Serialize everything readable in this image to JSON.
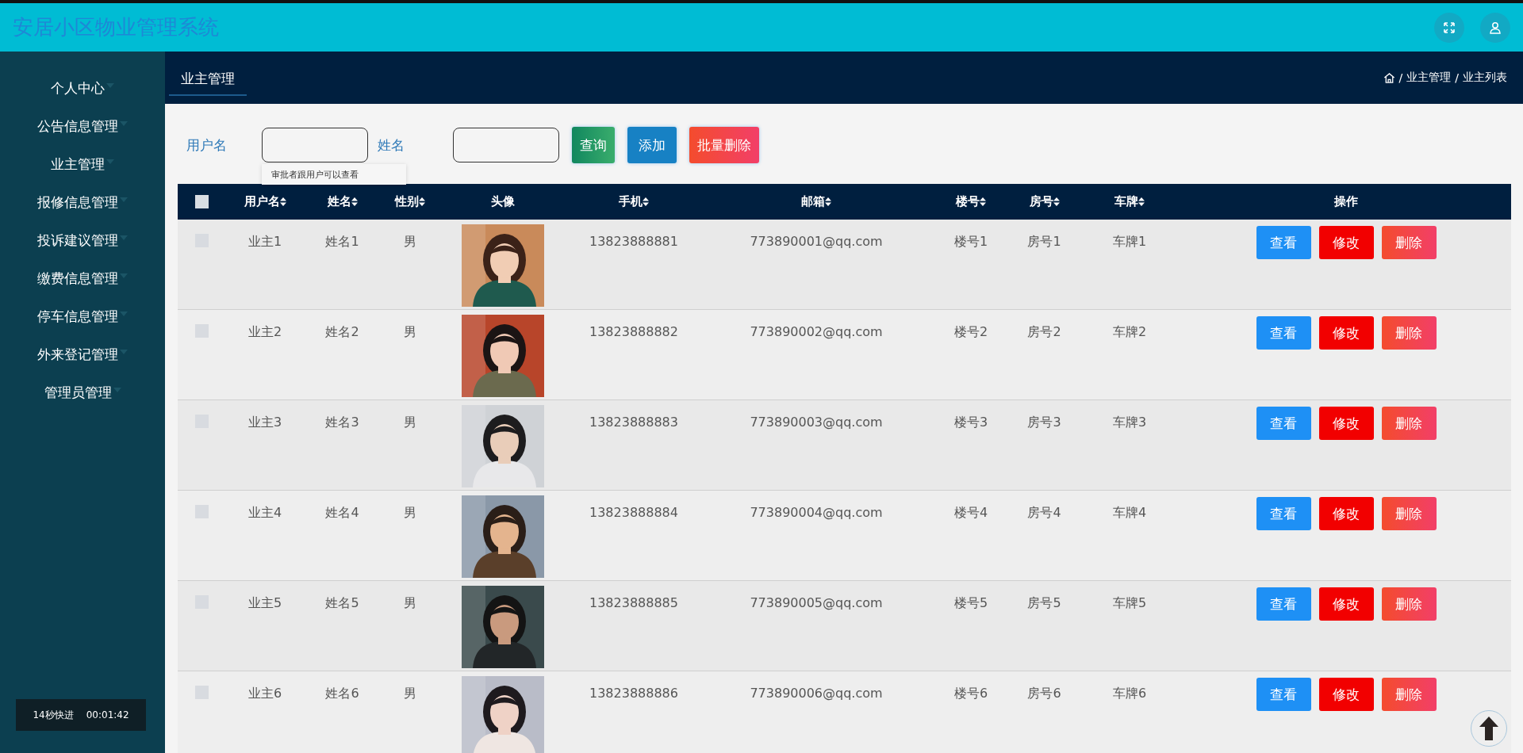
{
  "app": {
    "title": "安居小区物业管理系统"
  },
  "sidebar": {
    "items": [
      {
        "label": "个人中心"
      },
      {
        "label": "公告信息管理"
      },
      {
        "label": "业主管理"
      },
      {
        "label": "报修信息管理"
      },
      {
        "label": "投诉建议管理"
      },
      {
        "label": "缴费信息管理"
      },
      {
        "label": "停车信息管理"
      },
      {
        "label": "外来登记管理"
      },
      {
        "label": "管理员管理"
      }
    ]
  },
  "tab": {
    "label": "业主管理",
    "selected": true
  },
  "breadcrumb": [
    {
      "separator": "/",
      "label": "业主管理"
    },
    {
      "separator": "/",
      "label": "业主列表"
    }
  ],
  "search": {
    "fields": [
      {
        "label": "用户名"
      },
      {
        "label": "姓名"
      }
    ],
    "tooltip": "审批者跟用户可以查看",
    "buttons": [
      {
        "label": "查询",
        "kind": "search"
      },
      {
        "label": "添加",
        "kind": "add"
      },
      {
        "label": "批量删除",
        "kind": "delete"
      }
    ]
  },
  "table": {
    "select_all": {
      "checked": false
    },
    "columns": [
      {
        "label": "用户名",
        "sortable": true
      },
      {
        "label": "姓名",
        "sortable": true
      },
      {
        "label": "性别",
        "sortable": true
      },
      {
        "label": "头像",
        "sortable": false
      },
      {
        "label": "手机",
        "sortable": true
      },
      {
        "label": "邮箱",
        "sortable": true
      },
      {
        "label": "楼号",
        "sortable": true
      },
      {
        "label": "房号",
        "sortable": true
      },
      {
        "label": "车牌",
        "sortable": true
      },
      {
        "label": "操作",
        "sortable": false
      }
    ],
    "rows": [
      {
        "checked": false,
        "cells": [
          "业主1",
          "姓名1",
          "男",
          {
            "kind": "picture"
          },
          "13823888881",
          "773890001@qq.com",
          "楼号1",
          "房号1",
          "车牌1"
        ],
        "actions": [
          {
            "label": "查看",
            "kind": "view"
          },
          {
            "label": "修改",
            "kind": "edit"
          },
          {
            "label": "删除",
            "kind": "delete"
          }
        ]
      },
      {
        "checked": false,
        "cells": [
          "业主2",
          "姓名2",
          "男",
          {
            "kind": "picture"
          },
          "13823888882",
          "773890002@qq.com",
          "楼号2",
          "房号2",
          "车牌2"
        ],
        "actions": [
          {
            "label": "查看",
            "kind": "view"
          },
          {
            "label": "修改",
            "kind": "edit"
          },
          {
            "label": "删除",
            "kind": "delete"
          }
        ]
      },
      {
        "checked": false,
        "cells": [
          "业主3",
          "姓名3",
          "男",
          {
            "kind": "picture"
          },
          "13823888883",
          "773890003@qq.com",
          "楼号3",
          "房号3",
          "车牌3"
        ],
        "actions": [
          {
            "label": "查看",
            "kind": "view"
          },
          {
            "label": "修改",
            "kind": "edit"
          },
          {
            "label": "删除",
            "kind": "delete"
          }
        ]
      },
      {
        "checked": false,
        "cells": [
          "业主4",
          "姓名4",
          "男",
          {
            "kind": "picture"
          },
          "13823888884",
          "773890004@qq.com",
          "楼号4",
          "房号4",
          "车牌4"
        ],
        "actions": [
          {
            "label": "查看",
            "kind": "view"
          },
          {
            "label": "修改",
            "kind": "edit"
          },
          {
            "label": "删除",
            "kind": "delete"
          }
        ]
      },
      {
        "checked": false,
        "cells": [
          "业主5",
          "姓名5",
          "男",
          {
            "kind": "picture"
          },
          "13823888885",
          "773890005@qq.com",
          "楼号5",
          "房号5",
          "车牌5"
        ],
        "actions": [
          {
            "label": "查看",
            "kind": "view"
          },
          {
            "label": "修改",
            "kind": "edit"
          },
          {
            "label": "删除",
            "kind": "delete"
          }
        ]
      },
      {
        "checked": false,
        "cells": [
          "业主6",
          "姓名6",
          "男",
          {
            "kind": "picture"
          },
          "13823888886",
          "773890006@qq.com",
          "楼号6",
          "房号6",
          "车牌6"
        ],
        "actions": [
          {
            "label": "查看",
            "kind": "view"
          },
          {
            "label": "修改",
            "kind": "edit"
          },
          {
            "label": "删除",
            "kind": "delete"
          }
        ]
      }
    ]
  },
  "player_overlay": {
    "hint": "14秒快进",
    "time": "00:01:42"
  }
}
